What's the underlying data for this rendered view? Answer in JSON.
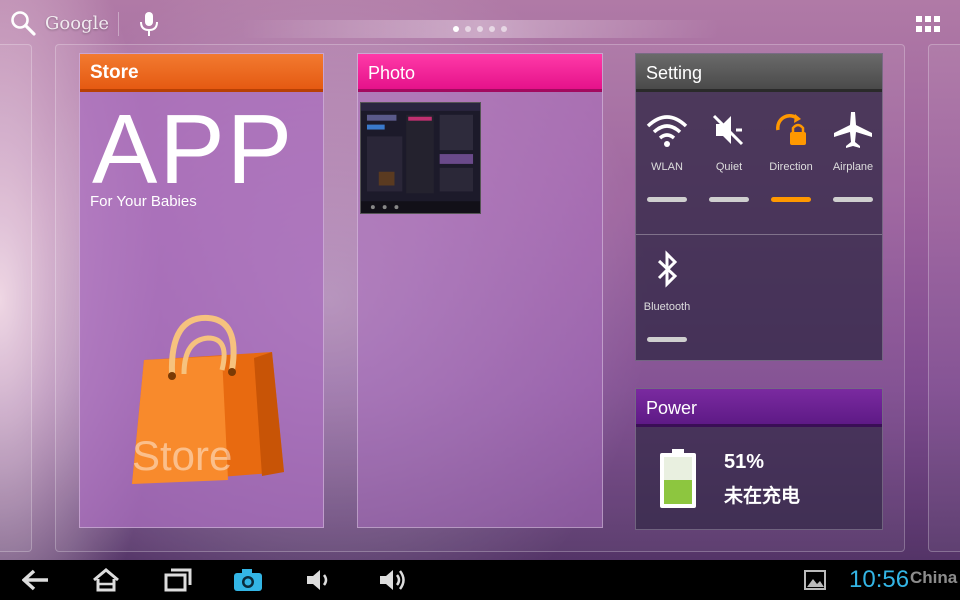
{
  "topbar": {
    "search_label": "Google",
    "page_count": 5,
    "active_page": 1
  },
  "widgets": {
    "store": {
      "title": "Store",
      "headline": "APP",
      "subtitle": "For Your Babies",
      "bag_label": "Store"
    },
    "photo": {
      "title": "Photo"
    },
    "setting": {
      "title": "Setting",
      "toggles": [
        {
          "label": "WLAN",
          "icon": "wifi-icon",
          "on": false
        },
        {
          "label": "Quiet",
          "icon": "speaker-muted-icon",
          "on": false
        },
        {
          "label": "Direction",
          "icon": "rotation-lock-icon",
          "on": true
        },
        {
          "label": "Airplane",
          "icon": "airplane-icon",
          "on": false
        },
        {
          "label": "Bluetooth",
          "icon": "bluetooth-icon",
          "on": false
        }
      ]
    },
    "power": {
      "title": "Power",
      "percent": "51%",
      "battery_level": 0.51,
      "status": "未在充电"
    }
  },
  "navbar": {
    "buttons": [
      "back-icon",
      "home-icon",
      "recent-apps-icon",
      "screenshot-icon",
      "volume-down-icon",
      "volume-up-icon"
    ],
    "time": "10:56",
    "watermark": "China"
  },
  "colors": {
    "store_header": "#e8621a",
    "photo_header": "#f0209a",
    "setting_header": "#585858",
    "power_header": "#6a1f92",
    "active_toggle": "#ff9800",
    "clock": "#33b5e5",
    "battery_fill": "#8dc63f"
  }
}
